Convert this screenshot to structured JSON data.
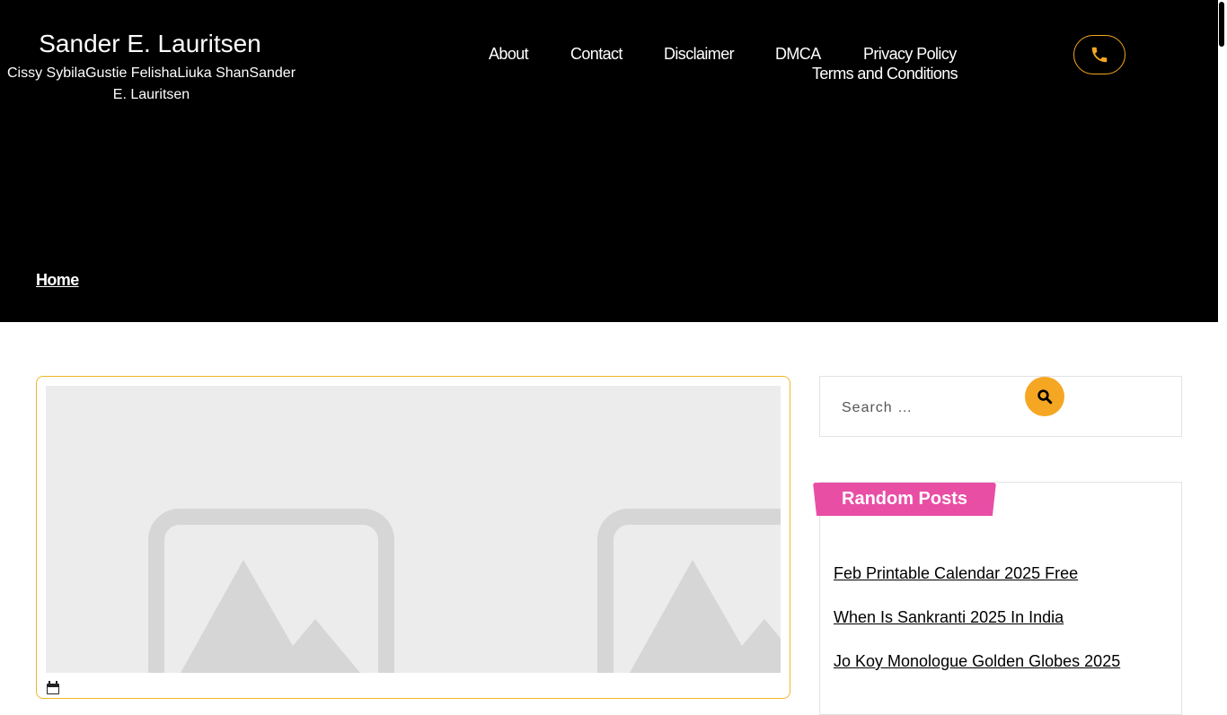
{
  "site": {
    "title": "Sander E. Lauritsen",
    "tagline": "Cissy SybilaGustie FelishaLiuka ShanSander E. Lauritsen"
  },
  "nav": {
    "about": "About",
    "contact": "Contact",
    "disclaimer": "Disclaimer",
    "dmca": "DMCA",
    "privacy": "Privacy Policy",
    "terms": "Terms and Conditions"
  },
  "header": {
    "phone_icon": "phone-icon"
  },
  "breadcrumb": {
    "home": "Home"
  },
  "post": {
    "image_icon": "image-placeholder-icon",
    "date_icon": "calendar-icon"
  },
  "search": {
    "placeholder": "Search …",
    "icon": "search-icon"
  },
  "random_posts": {
    "heading": "Random Posts",
    "items": [
      "Feb Printable Calendar 2025 Free",
      "When Is Sankranti 2025 In India",
      "Jo Koy Monologue Golden Globes 2025"
    ]
  },
  "colors": {
    "header_bg": "#000000",
    "accent": "#f5a623",
    "card_border": "#f0b62b",
    "heading_badge": "#e94ea5",
    "placeholder_bg": "#ececec"
  }
}
